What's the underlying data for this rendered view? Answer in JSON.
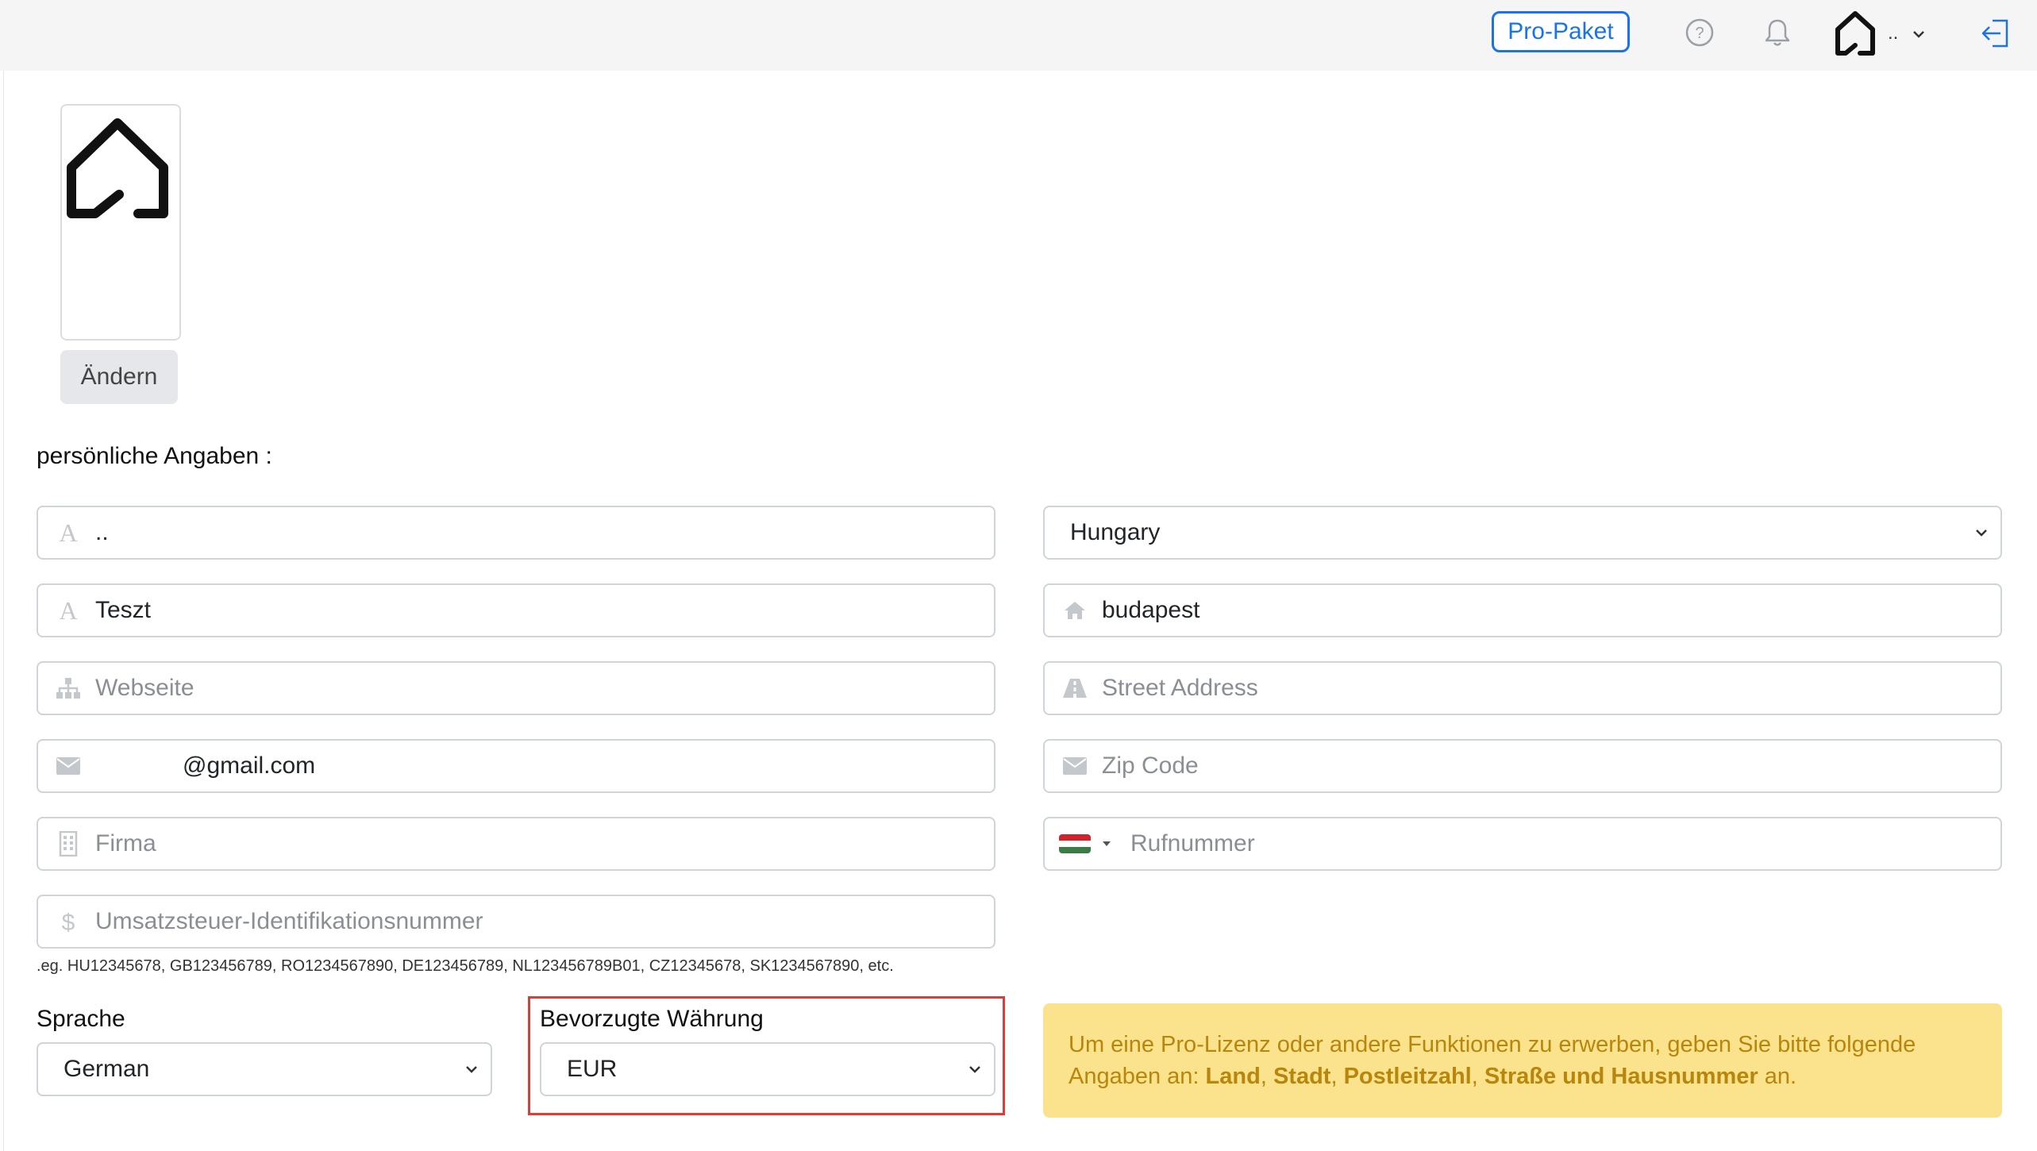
{
  "header": {
    "pro_button": "Pro-Paket",
    "user_name": "..",
    "icons": [
      "help-icon",
      "bell-icon",
      "home-logo-icon",
      "chevron-down-icon",
      "logout-icon"
    ]
  },
  "profile": {
    "change_button": "Ändern"
  },
  "section_title": "persönliche Angaben :",
  "left_fields": {
    "first_name": "..",
    "last_name": "Teszt",
    "website_placeholder": "Webseite",
    "email": "@gmail.com",
    "company_placeholder": "Firma",
    "vat_placeholder": "Umsatzsteuer-Identifikationsnummer",
    "vat_hint": ".eg. HU12345678, GB12345678​9, RO1234567890, DE123456789, NL123456789B01, CZ12345678, SK1234567890, etc."
  },
  "right_fields": {
    "country": "Hungary",
    "city": "budapest",
    "street_placeholder": "Street Address",
    "zip_placeholder": "Zip Code",
    "phone_placeholder": "Rufnummer"
  },
  "language": {
    "label": "Sprache",
    "value": "German"
  },
  "currency": {
    "label": "Bevorzugte Währung",
    "value": "EUR"
  },
  "notice": {
    "text_before": "Um eine Pro-Lizenz oder andere Funktionen zu erwerben, geben Sie bitte folgende Angaben an: ",
    "land": "Land",
    "stadt": "Stadt",
    "plz": "Postleitzahl",
    "street": "Straße und Hausnummer",
    "sep": ", ",
    "text_after": " an."
  },
  "colors": {
    "accent": "#1a73e8",
    "notice_bg": "#fbe28d",
    "notice_text": "#b8860b",
    "highlight": "#e53935"
  }
}
